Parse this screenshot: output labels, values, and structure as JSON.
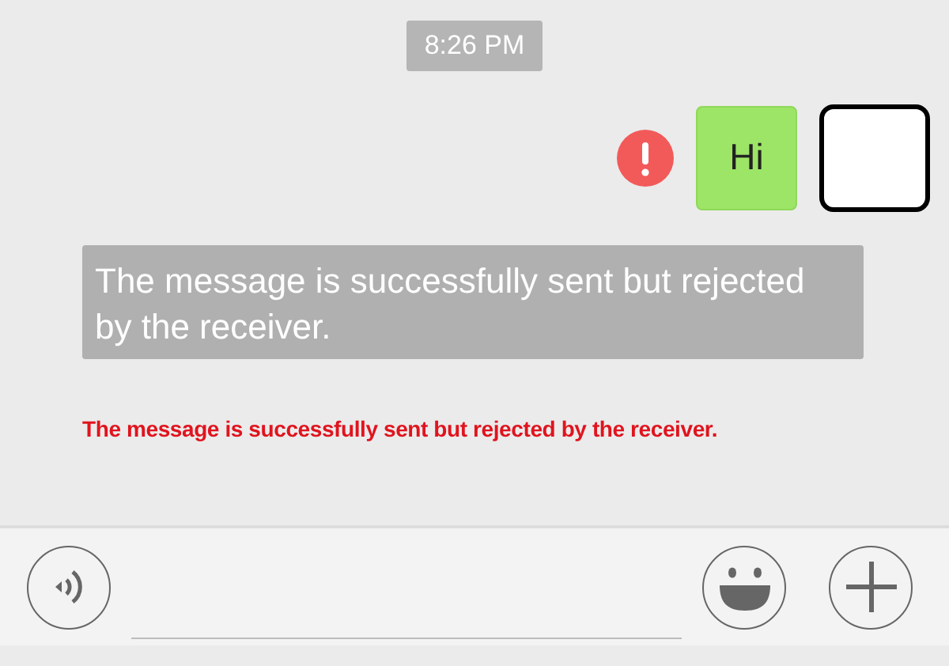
{
  "timestamp": "8:26 PM",
  "messages": [
    {
      "text": "Hi",
      "outgoing": true,
      "failed": true
    }
  ],
  "system_notice": "The message is successfully sent but rejected by the receiver.",
  "error_caption": "The message is successfully sent but rejected by the receiver."
}
